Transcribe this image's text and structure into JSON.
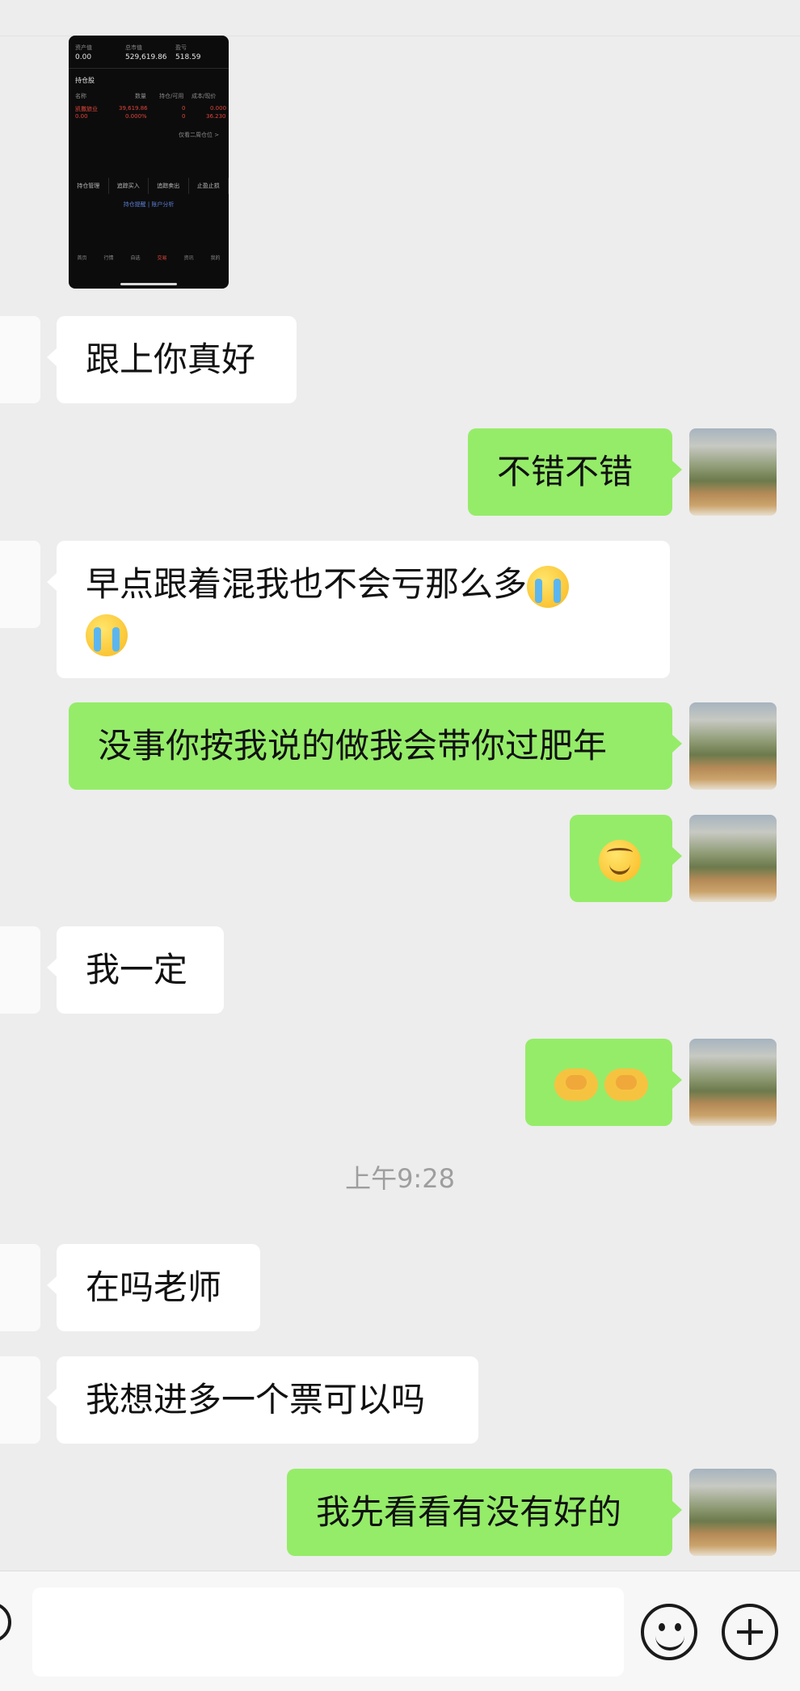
{
  "screenshot": {
    "header": {
      "label1": "资产值",
      "label2": "总市值",
      "label3": "盈亏",
      "v1": "0.00",
      "v2": "529,619.86",
      "v3": "518.59"
    },
    "section_title": "持仓股",
    "columns": [
      "名称",
      "数量",
      "持仓/可用",
      "成本/现价"
    ],
    "row": {
      "name": "凯撒旅业",
      "qty": "39,619.86",
      "hold": "0",
      "cost": "0.000"
    },
    "row2": {
      "name": "0.00",
      "qty": "0.000%",
      "hold": "0",
      "cost": "36.230"
    },
    "note": "仅看二周仓位 >",
    "buttons": [
      "持仓管理",
      "追踪买入",
      "追踪卖出",
      "止盈止损"
    ],
    "links": "持仓提醒 | 账户分析",
    "nav": [
      "首页",
      "行情",
      "自选",
      "交易",
      "资讯",
      "我的"
    ]
  },
  "messages": [
    {
      "side": "left",
      "text": "跟上你真好"
    },
    {
      "side": "right",
      "text": "不错不错"
    },
    {
      "side": "left",
      "text": "早点跟着混我也不会亏那么多"
    },
    {
      "side": "right",
      "text": "没事你按我说的做我会带你过肥年"
    },
    {
      "side": "right",
      "text": ""
    },
    {
      "side": "left",
      "text": "我一定"
    },
    {
      "side": "right",
      "text": ""
    },
    {
      "side": "left",
      "text": "在吗老师"
    },
    {
      "side": "left",
      "text": "我想进多一个票可以吗"
    },
    {
      "side": "right",
      "text": "我先看看有没有好的"
    }
  ],
  "timestamp": "上午9:28",
  "icons": {
    "emoji_button": "smiley-icon",
    "more_button": "plus-icon",
    "voice_button": "voice-icon"
  },
  "colors": {
    "bubble_self": "#95ec69",
    "bubble_other": "#ffffff",
    "background": "#ededed"
  }
}
